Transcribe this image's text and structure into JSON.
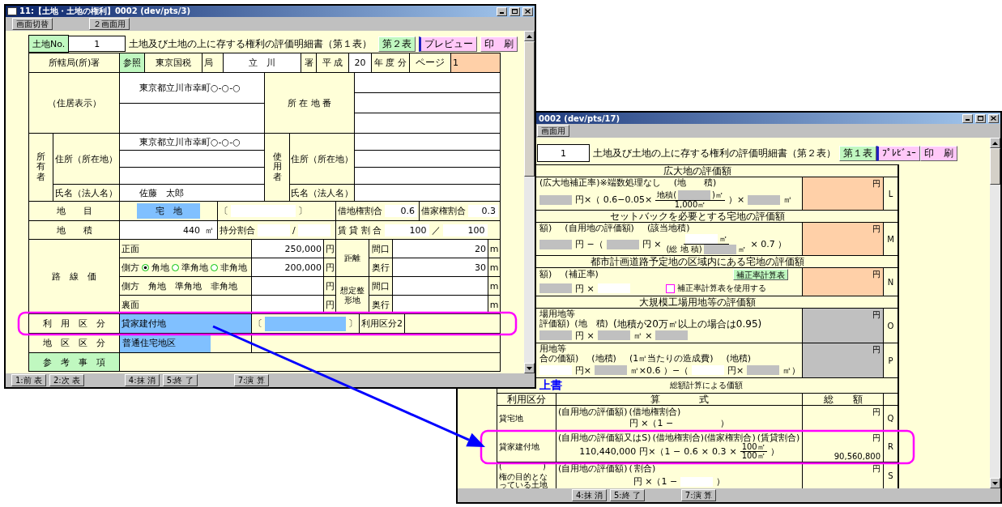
{
  "window1": {
    "title": "11:【土地・土地の権利】0002 (dev/pts/3)",
    "toolbar": [
      "画面切替",
      "２画面用"
    ],
    "form": {
      "header": {
        "no_label": "土地No.",
        "no_value": "1",
        "title": "土地及び土地の上に存する権利の評価明細書（第１表）",
        "buttons": [
          {
            "label": "第２表",
            "kind": "sheet"
          },
          {
            "label": "プレビュー",
            "kind": "preview"
          },
          {
            "label": "印　刷",
            "kind": "print"
          }
        ]
      },
      "office": {
        "label": "所轄局(所)署",
        "ref_button": "参照",
        "bureau": "東京国税",
        "bureau_unit": "局",
        "office": "立　川",
        "office_unit": "署",
        "era": "平 成",
        "year": "20",
        "year_unit": "年 度 分",
        "page_label": "ページ",
        "page": "1"
      },
      "residence": {
        "label": "（住居表示）",
        "address": "東京都立川市幸町○-○-○",
        "lot_label": "所 在 地 番"
      },
      "owner": {
        "label": "所有者",
        "address_label": "住所（所在地）",
        "address": "東京都立川市幸町○-○-○",
        "name_label": "氏名（法人名）",
        "name": "佐藤　太郎"
      },
      "user": {
        "label": "使用者",
        "address_label": "住所（所在地）",
        "name_label": "氏名（法人名）"
      },
      "land_category": {
        "label": "地　　目",
        "value": "宅　地",
        "bracket_open": "〔",
        "bracket_close": "〕",
        "leasehold_label": "借地権割合",
        "leasehold": "0.6",
        "tenancy_label": "借家権割合",
        "tenancy": "0.3"
      },
      "area": {
        "label": "地　　積",
        "value": "440",
        "unit": "㎡",
        "share_label": "持分割合",
        "share_sep": "/",
        "rental_label": "賃 貸 割 合",
        "rental": "100",
        "rental_sep": "／",
        "rental_total": "100"
      },
      "road_price": {
        "label": "路　線　価",
        "rows": [
          {
            "kind": "plain",
            "label": "正面",
            "value": "250,000",
            "unit": "円"
          },
          {
            "kind": "radio",
            "label": "側方",
            "options": [
              {
                "label": "角地",
                "selected": true
              },
              {
                "label": "準角地",
                "selected": false
              },
              {
                "label": "非角地",
                "selected": false
              }
            ],
            "value": "200,000",
            "unit": "円"
          },
          {
            "kind": "options",
            "label": "側方",
            "options": [
              "角地",
              "準角地",
              "非角地"
            ],
            "unit": "円"
          },
          {
            "kind": "plain",
            "label": "裏面",
            "unit": "円"
          }
        ],
        "groups": [
          {
            "label": "距離",
            "rows": [
              {
                "label": "間口",
                "value": "20",
                "unit": "m"
              },
              {
                "label": "奥行",
                "value": "30",
                "unit": "m"
              }
            ]
          },
          {
            "label": "想定整形地",
            "rows": [
              {
                "label": "間口",
                "unit": "m"
              },
              {
                "label": "奥行",
                "unit": "m"
              }
            ]
          }
        ]
      },
      "use_class": {
        "label": "利　用　区　分",
        "value": "貸家建付地",
        "bracket_open": "〔",
        "bracket_close": "〕",
        "label2": "利用区分2"
      },
      "district": {
        "label": "地　区　区　分",
        "value": "普通住宅地区"
      },
      "notes": {
        "label": "参　考　事　項"
      }
    },
    "footer": [
      "1:前 表",
      "2:次 表",
      "4:抹 消",
      "5:終 了",
      "7:演 算"
    ]
  },
  "window2": {
    "title": "0002 (dev/pts/17)",
    "toolbar": [
      "画面用"
    ],
    "form": {
      "header": {
        "no_value": "1",
        "title": "土地及び土地の上に存する権利の評価明細書（第２表）",
        "buttons": [
          {
            "label": "第１表",
            "kind": "sheet"
          },
          {
            "label": "ﾌﾟﾚﾋﾞｭｰ",
            "kind": "preview"
          },
          {
            "label": "印　刷",
            "kind": "print"
          }
        ]
      },
      "sections": [
        {
          "heading": "広大地の評価額",
          "rows": [
            {
              "lines": [
                {
                  "kind": "caption",
                  "items": [
                    "(広大地補正率)※端数処理なし",
                    "(地　　積)"
                  ]
                },
                {
                  "kind": "formula",
                  "items": [
                    {
                      "kind": "gray"
                    },
                    "円×（ 0.6−0.05×",
                    {
                      "kind": "fraction",
                      "numerator": [
                        "地積(",
                        {
                          "kind": "gray"
                        },
                        ")㎡"
                      ],
                      "denominator": [
                        "1,000㎡"
                      ]
                    },
                    "）×",
                    {
                      "kind": "gray"
                    },
                    "㎡"
                  ]
                }
              ],
              "amount": {
                "kind": "result",
                "unit": "円"
              },
              "letter": "L"
            }
          ]
        },
        {
          "heading": "セットバックを必要とする宅地の評価額",
          "rows": [
            {
              "lines": [
                {
                  "kind": "caption",
                  "items": [
                    "額)",
                    "(自用地の評価額)",
                    "(該当地積)"
                  ]
                },
                {
                  "kind": "formula",
                  "items": [
                    {
                      "kind": "gray"
                    },
                    "円 −（",
                    {
                      "kind": "gray"
                    },
                    "円 ×",
                    {
                      "kind": "fraction",
                      "numerator": [
                        {
                          "kind": "white"
                        },
                        "㎡"
                      ],
                      "denominator": [
                        "(総 地 積)",
                        {
                          "kind": "gray"
                        },
                        "㎡"
                      ]
                    },
                    "× 0.7 ）"
                  ]
                }
              ],
              "amount": {
                "kind": "result",
                "unit": "円"
              },
              "letter": "M"
            }
          ]
        },
        {
          "heading": "都市計画道路予定地の区域内にある宅地の評価額",
          "rows": [
            {
              "lines": [
                {
                  "kind": "caption",
                  "items": [
                    "額)",
                    "(補正率)",
                    {
                      "kind": "button",
                      "label": "補正率計算表"
                    }
                  ]
                },
                {
                  "kind": "formula",
                  "items": [
                    {
                      "kind": "gray"
                    },
                    "円 ×",
                    {
                      "kind": "white"
                    },
                    {
                      "kind": "checkbox",
                      "label": "補正率計算表を使用する",
                      "checked": false
                    }
                  ]
                }
              ],
              "amount": {
                "kind": "result",
                "unit": "円"
              },
              "letter": "N"
            }
          ]
        },
        {
          "heading": "大規模工場用地等の評価額",
          "rows": [
            {
              "lines": [
                {
                  "kind": "caption",
                  "items": [
                    "場用地等"
                  ]
                },
                {
                  "kind": "caption",
                  "items": [
                    "評価額)",
                    "(地　積)",
                    "(地積が20万㎡以上の場合は0.95)"
                  ]
                },
                {
                  "kind": "formula",
                  "items": [
                    {
                      "kind": "gray"
                    },
                    "円 ×",
                    {
                      "kind": "gray"
                    },
                    "㎡ ×",
                    {
                      "kind": "gray"
                    }
                  ]
                }
              ],
              "amount": {
                "kind": "disabled",
                "unit": "円"
              },
              "letter": "O"
            },
            {
              "lines": [
                {
                  "kind": "caption",
                  "items": [
                    "用地等"
                  ]
                },
                {
                  "kind": "caption",
                  "items": [
                    "合の価額)",
                    "(地積)",
                    "(1㎡当たりの造成費)",
                    "(地積)"
                  ]
                },
                {
                  "kind": "formula",
                  "items": [
                    {
                      "kind": "white"
                    },
                    "円×",
                    {
                      "kind": "gray"
                    },
                    "㎡×0.6 ）−（",
                    {
                      "kind": "white"
                    },
                    "円×",
                    {
                      "kind": "gray"
                    },
                    "㎡）"
                  ]
                }
              ],
              "amount": {
                "kind": "disabled",
                "unit": "円"
              },
              "letter": "P"
            }
          ]
        }
      ],
      "total": {
        "overlay_title": "上書",
        "heading": "総額計算による価額",
        "columns": [
          "利用区分",
          "算　　　　式",
          "総　　額"
        ],
        "rows": [
          {
            "use": [
              "貸宅地"
            ],
            "lines": [
              {
                "kind": "caption",
                "items": [
                  "(自用地の評価額)",
                  "(借地権割合)"
                ]
              },
              {
                "kind": "formula",
                "items": [
                  "円 ×（1 −",
                  {
                    "kind": "gap"
                  },
                  "）"
                ]
              }
            ],
            "amount": {
              "kind": "plain",
              "unit": "円"
            },
            "letter": "Q"
          },
          {
            "use": [
              "貸家建付地"
            ],
            "lines": [
              {
                "kind": "caption",
                "items": [
                  "(自用地の評価額又はS)",
                  "(借地権割合)(借家権割合)",
                  "(賃貸割合)"
                ]
              },
              {
                "kind": "formula",
                "items": [
                  "110,440,000",
                  "円×（1 −",
                  "0.6",
                  "×",
                  "0.3",
                  "×",
                  {
                    "kind": "fraction",
                    "numerator": [
                      "100㎡"
                    ],
                    "denominator": [
                      "100㎡"
                    ]
                  },
                  "）"
                ]
              }
            ],
            "amount": {
              "kind": "plain",
              "unit": "円",
              "value": "90,560,800"
            },
            "letter": "R"
          },
          {
            "use": [
              "(　　　　　)",
              "権の目的となっている土地"
            ],
            "lines": [
              {
                "kind": "caption",
                "items": [
                  "(自用地の評価額)",
                  "(",
                  "割合)"
                ]
              },
              {
                "kind": "formula",
                "items": [
                  "円 ×（1 −",
                  {
                    "kind": "white"
                  },
                  "）"
                ]
              }
            ],
            "amount": {
              "kind": "plain",
              "unit": "円"
            },
            "letter": "S"
          }
        ]
      }
    },
    "footer": [
      "4:抹 消",
      "5:終 了",
      "7:演 算"
    ]
  },
  "annotations": [
    {
      "kind": "highlight"
    },
    {
      "kind": "highlight"
    },
    {
      "kind": "arrow"
    }
  ]
}
